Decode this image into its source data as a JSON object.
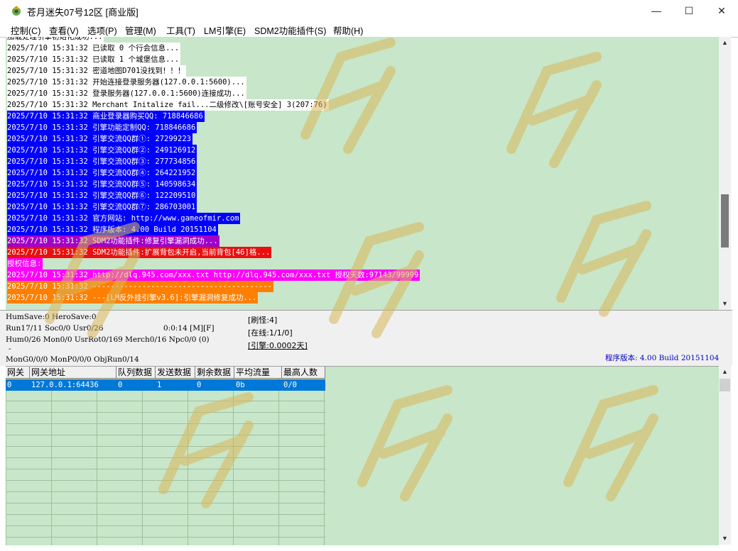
{
  "window": {
    "title": "苍月迷失07号12区 [商业版]",
    "minimize_glyph": "—",
    "maximize_glyph": "☐",
    "close_glyph": "✕",
    "icon": "app-icon"
  },
  "menu": [
    "控制(C)",
    "查看(V)",
    "选项(P)",
    "管理(M)",
    "工具(T)",
    "LM引擎(E)",
    "SDM2功能插件(S)",
    "帮助(H)"
  ],
  "log": [
    {
      "text": "加载处理引擎初始化成功...",
      "fg": "#000000",
      "bg": "#ffffff"
    },
    {
      "text": "2025/7/10 15:31:32 已读取 0 个行会信息...",
      "fg": "#000000",
      "bg": "#ffffff"
    },
    {
      "text": "2025/7/10 15:31:32 已读取 1 个城堡信息...",
      "fg": "#000000",
      "bg": "#ffffff"
    },
    {
      "text": "2025/7/10 15:31:32 密道地图D701没找到！！！",
      "fg": "#000000",
      "bg": "#ffffff"
    },
    {
      "text": "2025/7/10 15:31:32 开始连接登录服务器(127.0.0.1:5600)...",
      "fg": "#000000",
      "bg": "#ffffff"
    },
    {
      "text": "2025/7/10 15:31:32 登录服务器(127.0.0.1:5600)连接成功...",
      "fg": "#000000",
      "bg": "#ffffff"
    },
    {
      "text": "2025/7/10 15:31:32 Merchant Initalize fail...二级修改\\[账号安全] 3(207:76)",
      "fg": "#000000",
      "bg": "#ffffff"
    },
    {
      "text": "2025/7/10 15:31:32 商业登录器购买QQ: 718846686",
      "fg": "#ffffff",
      "bg": "#0000ff"
    },
    {
      "text": "2025/7/10 15:31:32 引擎功能定制QQ: 718846686",
      "fg": "#ffffff",
      "bg": "#0000ff"
    },
    {
      "text": "2025/7/10 15:31:32 引擎交流QQ群①: 27299223",
      "fg": "#ffffff",
      "bg": "#0000ff"
    },
    {
      "text": "2025/7/10 15:31:32 引擎交流QQ群②: 249126912",
      "fg": "#ffffff",
      "bg": "#0000ff"
    },
    {
      "text": "2025/7/10 15:31:32 引擎交流QQ群③: 277734856",
      "fg": "#ffffff",
      "bg": "#0000ff"
    },
    {
      "text": "2025/7/10 15:31:32 引擎交流QQ群④: 264221952",
      "fg": "#ffffff",
      "bg": "#0000ff"
    },
    {
      "text": "2025/7/10 15:31:32 引擎交流QQ群⑤: 140598634",
      "fg": "#ffffff",
      "bg": "#0000ff"
    },
    {
      "text": "2025/7/10 15:31:32 引擎交流QQ群⑥: 122209510",
      "fg": "#ffffff",
      "bg": "#0000ff"
    },
    {
      "text": "2025/7/10 15:31:32 引擎交流QQ群⑦: 286703001",
      "fg": "#ffffff",
      "bg": "#0000ff"
    },
    {
      "text": "2025/7/10 15:31:32 官方网站: http://www.gameofmir.com",
      "fg": "#ffffff",
      "bg": "#0000ff"
    },
    {
      "text": "2025/7/10 15:31:32 程序版本: 4.00 Build 20151104",
      "fg": "#ffffff",
      "bg": "#0000ff"
    },
    {
      "text": "2025/7/10 15:31:32 SDM2功能插件:修复引擎漏洞成功...",
      "fg": "#ffffff",
      "bg": "#a000c8"
    },
    {
      "text": "2025/7/10 15:31:32 SDM2功能插件:扩展背包未开启,当前背包[46]格...",
      "fg": "#ffffff",
      "bg": "#e81010"
    },
    {
      "text": "授权信息:",
      "fg": "#ffffff",
      "bg": "#ff00ff"
    },
    {
      "text": "2025/7/10 15:31:32 http://dlq.945.com/xxx.txt http://dlq.945.com/xxx.txt 授权天数:97143/99999",
      "fg": "#ffffff",
      "bg": "#ff00ff"
    },
    {
      "text": "2025/7/10 15:31:32 ----------------------------------------",
      "fg": "#ffffff",
      "bg": "#ff7f00"
    },
    {
      "text": "2025/7/10 15:31:32 ---[LM反外挂引擎v3.6]:引擎漏洞修复成功...",
      "fg": "#ffffff",
      "bg": "#ff7f00"
    }
  ],
  "status": {
    "line1": "HumSave:0 HeroSave:0",
    "line2": "Run17/11 Soc0/0 Usr0/26",
    "line2_time": "0:0:14 [M][F]",
    "line3": "Hum0/26 Mon0/0 UsrRot0/169 Merch0/16 Npc0/0 (0)",
    "line4": "-",
    "line5": "MonG0/0/0 MonP0/0/0 ObjRun0/14",
    "refresh": "[刷怪:4]",
    "online": "[在线:1/1/0]",
    "engine": "[引擎:0.0002天]",
    "version": "程序版本: 4.00 Build 20151104"
  },
  "gateway": {
    "headers": [
      "网关",
      "网关地址",
      "队列数据",
      "发送数据",
      "剩余数据",
      "平均流量",
      "最高人数"
    ],
    "rows": [
      [
        "0",
        "127.0.0.1:64436",
        "0",
        "1",
        "0",
        "0b",
        "0/0"
      ]
    ]
  },
  "colors": {
    "log_bg": "#c8e6c9",
    "selection": "#0078d7",
    "version_text": "#0000c0"
  }
}
